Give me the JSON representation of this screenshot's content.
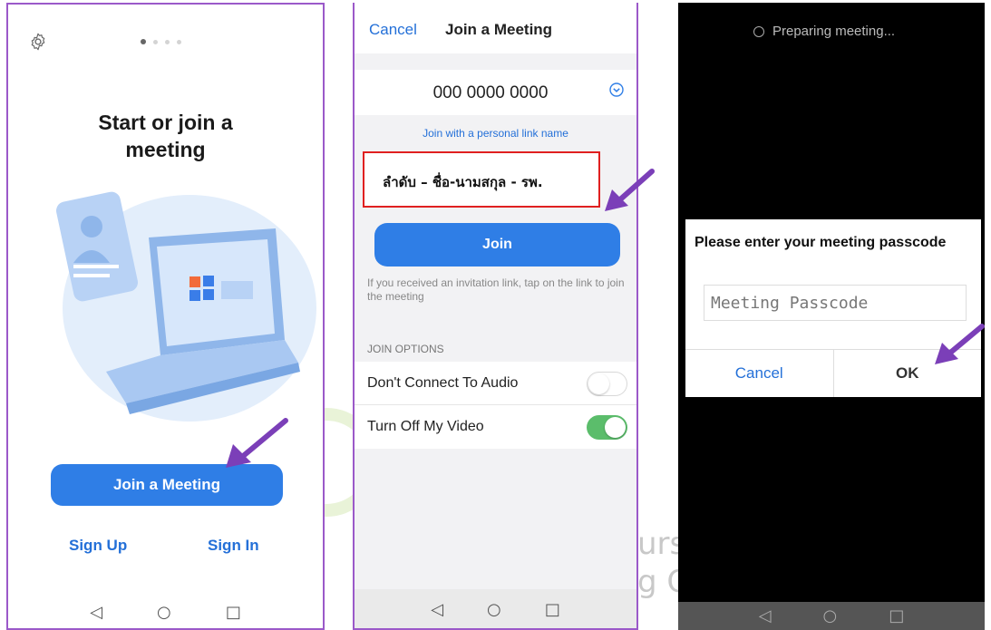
{
  "screen1": {
    "title": "Start or join a\nmeeting",
    "join_button": "Join a Meeting",
    "sign_up": "Sign Up",
    "sign_in": "Sign In",
    "settings_icon": "gear-icon",
    "page_dots": 4,
    "active_dot": 1
  },
  "screen2": {
    "cancel": "Cancel",
    "title": "Join a Meeting",
    "meeting_id": "000 0000 0000",
    "personal_link": "Join with a personal link name",
    "name_value": "ลำดับ – ชื่อ-นามสกุล - รพ.",
    "join_button": "Join",
    "hint": "If you received an invitation link, tap on the link to join the meeting",
    "options_header": "JOIN OPTIONS",
    "options": [
      {
        "label": "Don't Connect To Audio",
        "on": false
      },
      {
        "label": "Turn Off My Video",
        "on": true
      }
    ]
  },
  "screen3": {
    "status": "Preparing meeting...",
    "dialog_title": "Please enter your meeting passcode",
    "passcode_placeholder": "Meeting Passcode",
    "cancel": "Cancel",
    "ok": "OK"
  },
  "nav": {
    "back": "◁",
    "home": "○",
    "recent": "□"
  },
  "watermark": {
    "line1": "urs",
    "line2": "g C"
  },
  "colors": {
    "accent": "#2f7ee6",
    "link": "#2470d8",
    "toggle_on": "#5bbd6b",
    "arrow": "#7b3fb8",
    "frame": "#9b59c9",
    "highlight_border": "#e02020"
  }
}
